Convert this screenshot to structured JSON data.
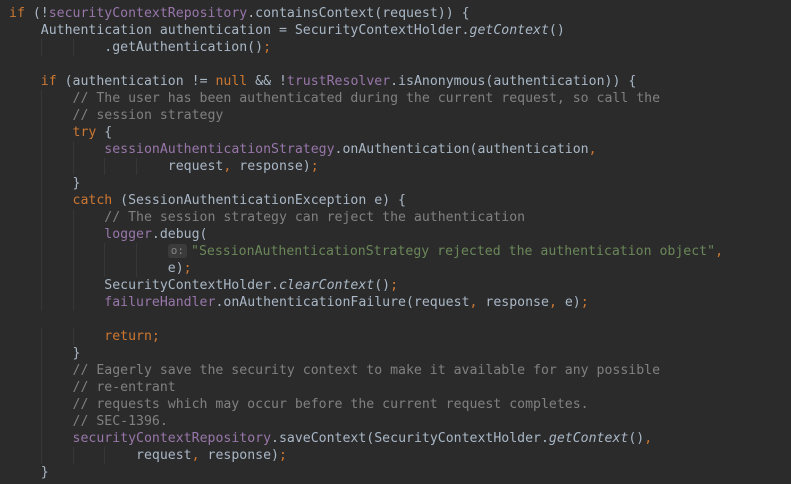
{
  "editor": {
    "colors": {
      "background": "#2b2b2b",
      "default": "#a9b7c6",
      "keyword": "#cc7832",
      "field": "#9876aa",
      "comment": "#808080",
      "string": "#6a8759"
    },
    "lines": [
      {
        "tokens": [
          {
            "t": "if",
            "c": "kw"
          },
          {
            "t": " (!"
          },
          {
            "t": "securityContextRepository",
            "c": "fld"
          },
          {
            "t": ".containsContext(request)) {"
          }
        ]
      },
      {
        "tokens": [
          {
            "t": "    Authentication authentication = SecurityContextHolder."
          },
          {
            "t": "getContext",
            "c": "sm"
          },
          {
            "t": "()"
          }
        ]
      },
      {
        "tokens": [
          {
            "t": "            .getAuthentication()"
          },
          {
            "t": ";",
            "c": "kw"
          }
        ]
      },
      {
        "tokens": []
      },
      {
        "tokens": [
          {
            "t": "    "
          },
          {
            "t": "if",
            "c": "kw"
          },
          {
            "t": " (authentication != "
          },
          {
            "t": "null",
            "c": "kw"
          },
          {
            "t": " && !"
          },
          {
            "t": "trustResolver",
            "c": "fld"
          },
          {
            "t": ".isAnonymous(authentication)) {"
          }
        ]
      },
      {
        "tokens": [
          {
            "t": "        // The user has been authenticated during the current request, so call the",
            "c": "cmt"
          }
        ]
      },
      {
        "tokens": [
          {
            "t": "        // session strategy",
            "c": "cmt"
          }
        ]
      },
      {
        "tokens": [
          {
            "t": "        "
          },
          {
            "t": "try",
            "c": "kw"
          },
          {
            "t": " {"
          }
        ]
      },
      {
        "tokens": [
          {
            "t": "            "
          },
          {
            "t": "sessionAuthenticationStrategy",
            "c": "fld"
          },
          {
            "t": ".onAuthentication(authentication"
          },
          {
            "t": ",",
            "c": "kw"
          }
        ]
      },
      {
        "tokens": [
          {
            "t": "                    request"
          },
          {
            "t": ",",
            "c": "kw"
          },
          {
            "t": " response)"
          },
          {
            "t": ";",
            "c": "kw"
          }
        ]
      },
      {
        "tokens": [
          {
            "t": "        }"
          }
        ]
      },
      {
        "tokens": [
          {
            "t": "        "
          },
          {
            "t": "catch",
            "c": "kw"
          },
          {
            "t": " (SessionAuthenticationException e) {"
          }
        ]
      },
      {
        "tokens": [
          {
            "t": "            // The session strategy can reject the authentication",
            "c": "cmt"
          }
        ]
      },
      {
        "tokens": [
          {
            "t": "            "
          },
          {
            "t": "logger",
            "c": "fld"
          },
          {
            "t": ".debug("
          }
        ]
      },
      {
        "tokens": [
          {
            "t": "                    "
          },
          {
            "t": "o:",
            "c": "hint"
          },
          {
            "t": "\"SessionAuthenticationStrategy rejected the authentication object\"",
            "c": "str"
          },
          {
            "t": ",",
            "c": "kw"
          }
        ]
      },
      {
        "tokens": [
          {
            "t": "                    e)"
          },
          {
            "t": ";",
            "c": "kw"
          }
        ]
      },
      {
        "tokens": [
          {
            "t": "            SecurityContextHolder."
          },
          {
            "t": "clearContext",
            "c": "sm"
          },
          {
            "t": "()"
          },
          {
            "t": ";",
            "c": "kw"
          }
        ]
      },
      {
        "tokens": [
          {
            "t": "            "
          },
          {
            "t": "failureHandler",
            "c": "fld"
          },
          {
            "t": ".onAuthenticationFailure(request"
          },
          {
            "t": ",",
            "c": "kw"
          },
          {
            "t": " response"
          },
          {
            "t": ",",
            "c": "kw"
          },
          {
            "t": " e)"
          },
          {
            "t": ";",
            "c": "kw"
          }
        ]
      },
      {
        "tokens": []
      },
      {
        "tokens": [
          {
            "t": "            "
          },
          {
            "t": "return;",
            "c": "kw"
          }
        ]
      },
      {
        "tokens": [
          {
            "t": "        }"
          }
        ]
      },
      {
        "tokens": [
          {
            "t": "        // Eagerly save the security context to make it available for any possible",
            "c": "cmt"
          }
        ]
      },
      {
        "tokens": [
          {
            "t": "        // re-entrant",
            "c": "cmt"
          }
        ]
      },
      {
        "tokens": [
          {
            "t": "        // requests which may occur before the current request completes.",
            "c": "cmt"
          }
        ]
      },
      {
        "tokens": [
          {
            "t": "        // SEC-1396.",
            "c": "cmt"
          }
        ]
      },
      {
        "tokens": [
          {
            "t": "        "
          },
          {
            "t": "securityContextRepository",
            "c": "fld"
          },
          {
            "t": ".saveContext(SecurityContextHolder."
          },
          {
            "t": "getContext",
            "c": "sm"
          },
          {
            "t": "()"
          },
          {
            "t": ",",
            "c": "kw"
          }
        ]
      },
      {
        "tokens": [
          {
            "t": "                request"
          },
          {
            "t": ",",
            "c": "kw"
          },
          {
            "t": " response)"
          },
          {
            "t": ";",
            "c": "kw"
          }
        ]
      },
      {
        "tokens": [
          {
            "t": "    }"
          }
        ]
      }
    ]
  }
}
